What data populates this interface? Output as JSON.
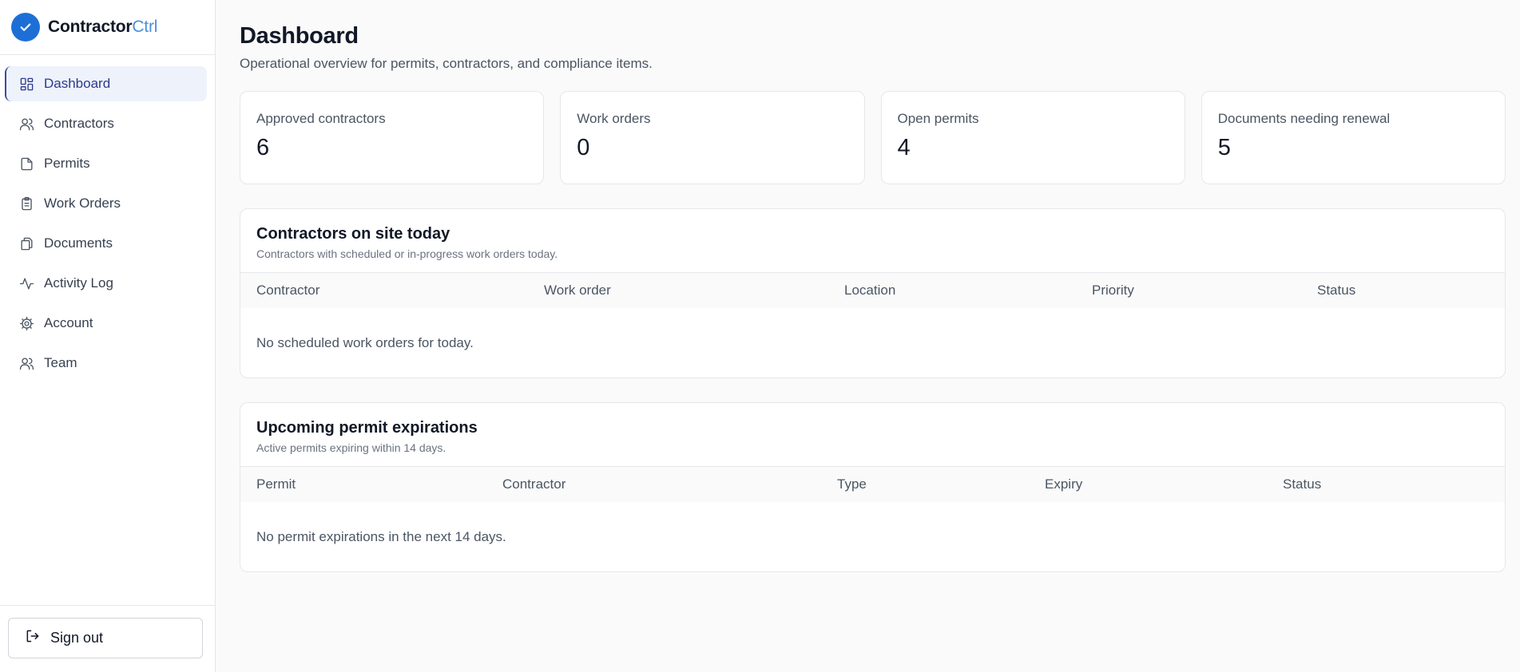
{
  "brand": {
    "name": "Contractor",
    "accent": "Ctrl",
    "color": "#1d6fd6"
  },
  "sidebar": {
    "items": [
      {
        "label": "Dashboard",
        "icon": "dashboard-icon",
        "active": true
      },
      {
        "label": "Contractors",
        "icon": "users-icon"
      },
      {
        "label": "Permits",
        "icon": "file-icon"
      },
      {
        "label": "Work Orders",
        "icon": "clipboard-icon"
      },
      {
        "label": "Documents",
        "icon": "documents-icon"
      },
      {
        "label": "Activity Log",
        "icon": "activity-icon"
      },
      {
        "label": "Account",
        "icon": "gear-icon"
      },
      {
        "label": "Team",
        "icon": "team-icon"
      }
    ],
    "signout_label": "Sign out"
  },
  "page": {
    "title": "Dashboard",
    "subtitle": "Operational overview for permits, contractors, and compliance items."
  },
  "stats": [
    {
      "label": "Approved contractors",
      "value": "6"
    },
    {
      "label": "Work orders",
      "value": "0"
    },
    {
      "label": "Open permits",
      "value": "4"
    },
    {
      "label": "Documents needing renewal",
      "value": "5"
    }
  ],
  "onsite": {
    "title": "Contractors on site today",
    "description": "Contractors with scheduled or in-progress work orders today.",
    "columns": [
      "Contractor",
      "Work order",
      "Location",
      "Priority",
      "Status"
    ],
    "empty": "No scheduled work orders for today."
  },
  "expirations": {
    "title": "Upcoming permit expirations",
    "description": "Active permits expiring within 14 days.",
    "columns": [
      "Permit",
      "Contractor",
      "Type",
      "Expiry",
      "Status"
    ],
    "empty": "No permit expirations in the next 14 days."
  }
}
